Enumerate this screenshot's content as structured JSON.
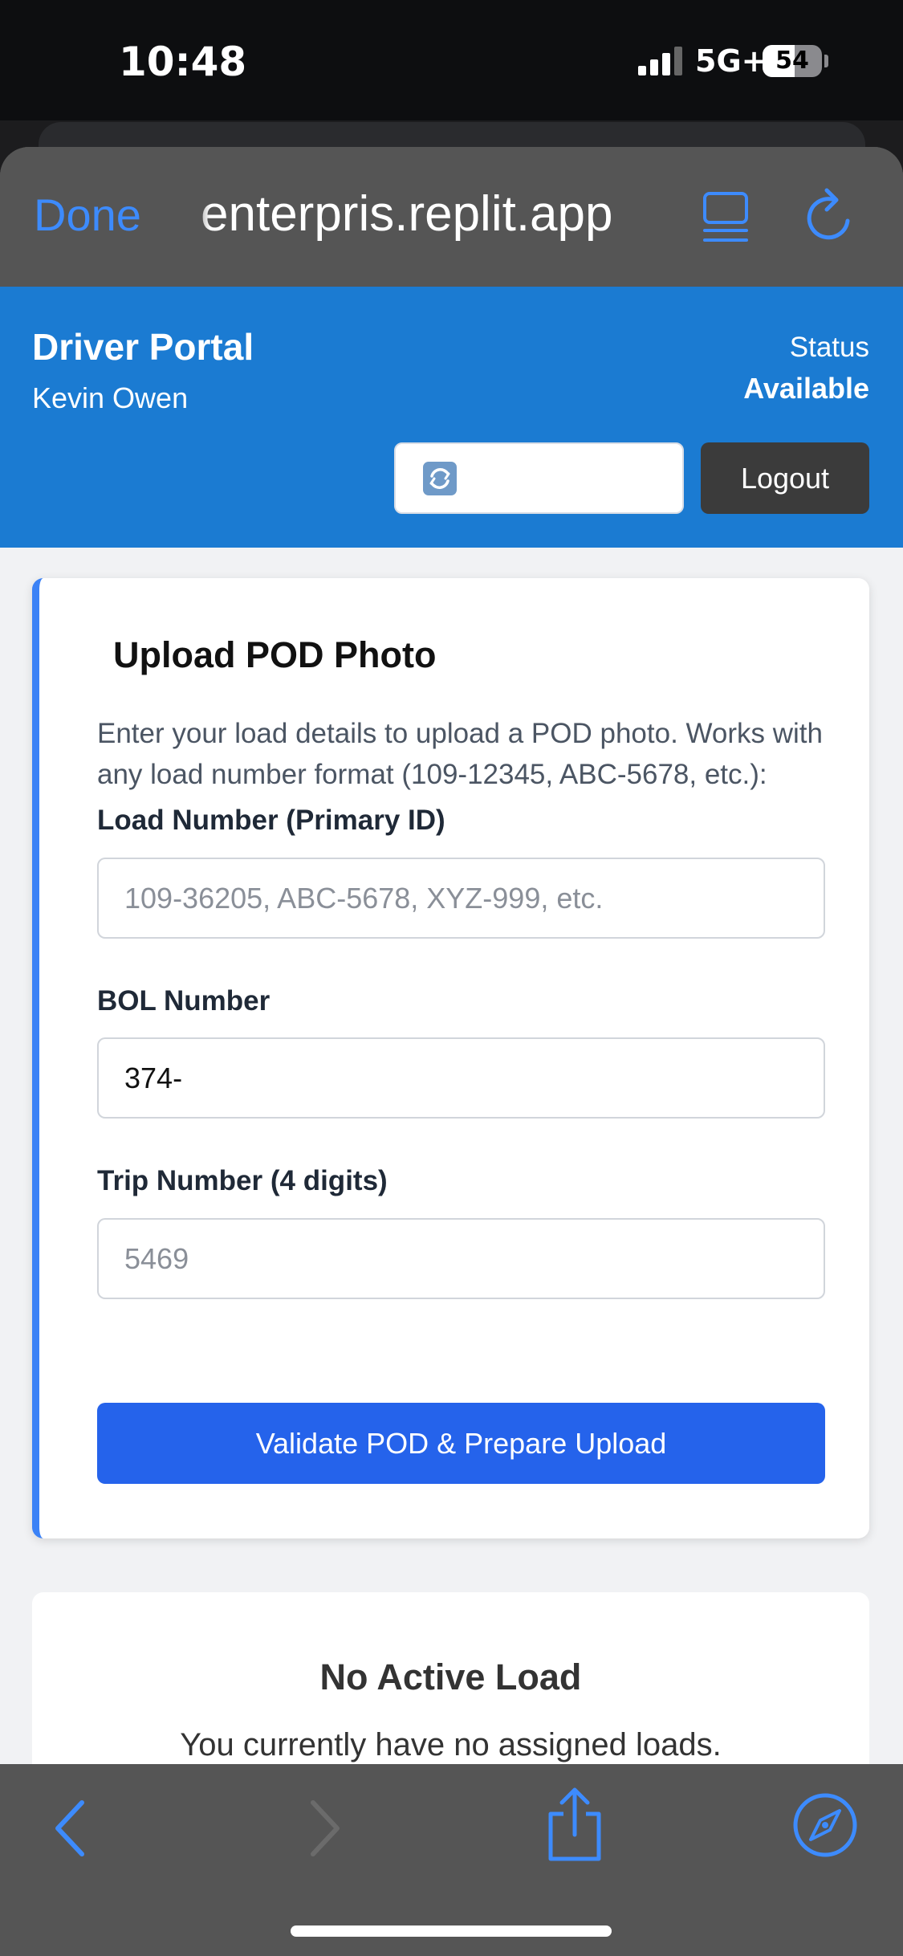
{
  "status_bar": {
    "time": "10:48",
    "network": "5G+",
    "battery": "54"
  },
  "browser": {
    "done_label": "Done",
    "url": "enterpris.replit.app",
    "icons": {
      "reader": "reader-mode-icon",
      "reload": "reload-icon",
      "back": "back-chevron-icon",
      "forward": "forward-chevron-icon",
      "share": "share-icon",
      "safari": "compass-icon"
    },
    "accent_color": "#3d8bfd"
  },
  "header": {
    "title": "Driver Portal",
    "driver_name": "Kevin Owen",
    "status_label": "Status",
    "status_value": "Available",
    "refresh_field_icon": "refresh-emoji-icon",
    "logout_label": "Logout",
    "color": "#1b7bd2"
  },
  "upload": {
    "title": "Upload POD Photo",
    "description": "Enter your load details to upload a POD photo. Works with any load number format (109-12345, ABC-5678, etc.):",
    "load_number": {
      "label": "Load Number (Primary ID)",
      "value": "",
      "placeholder": "109-36205, ABC-5678, XYZ-999, etc."
    },
    "bol_number": {
      "label": "BOL Number",
      "value": "374-",
      "placeholder": ""
    },
    "trip_number": {
      "label": "Trip Number (4 digits)",
      "value": "",
      "placeholder": "5469"
    },
    "submit_label": "Validate POD & Prepare Upload",
    "accent_color": "#2563eb",
    "border_color": "#3b82f6"
  },
  "no_load": {
    "title": "No Active Load",
    "text": "You currently have no assigned loads."
  }
}
